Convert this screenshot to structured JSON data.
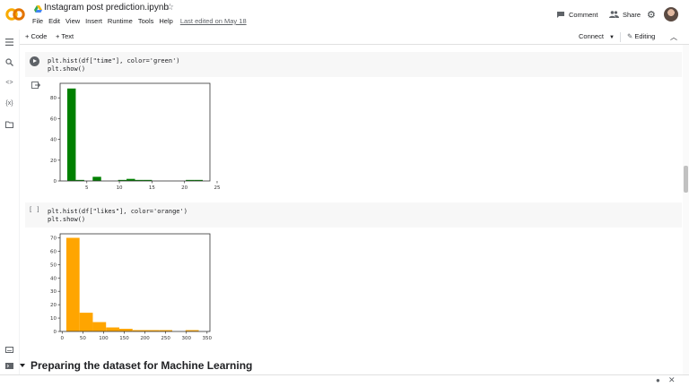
{
  "header": {
    "title": "Instagram post prediction.ipynb",
    "menu": [
      "File",
      "Edit",
      "View",
      "Insert",
      "Runtime",
      "Tools",
      "Help"
    ],
    "last_edited": "Last edited on May 18",
    "comment_label": "Comment",
    "share_label": "Share"
  },
  "toolbar": {
    "add_code": "+ Code",
    "add_text": "+ Text",
    "connect": "Connect",
    "editing": "Editing"
  },
  "cells": [
    {
      "run_state": "run-button",
      "code_lines": [
        "plt.hist(df[\"time\"], color='green')",
        "plt.show()"
      ]
    },
    {
      "run_state": "[ ]",
      "code_lines": [
        "plt.hist(df[\"likes\"], color='orange')",
        "plt.show()"
      ]
    }
  ],
  "section": {
    "title": "Preparing the dataset for Machine Learning"
  },
  "colors": {
    "green": "#008000",
    "orange": "#ffa500",
    "accent": "#f9ab00"
  },
  "chart_data": [
    {
      "type": "bar",
      "title": "",
      "xlabel": "",
      "ylabel": "",
      "color": "#008000",
      "bins": [
        [
          2,
          3.3
        ],
        [
          3.3,
          4.6
        ],
        [
          4.6,
          5.9
        ],
        [
          5.9,
          7.2
        ],
        [
          7.2,
          8.5
        ],
        [
          8.5,
          9.8
        ],
        [
          9.8,
          11.1
        ],
        [
          11.1,
          12.4
        ],
        [
          12.4,
          13.7
        ],
        [
          13.7,
          15.0
        ],
        [
          15.0,
          16.3
        ],
        [
          16.3,
          17.6
        ],
        [
          17.6,
          18.9
        ],
        [
          18.9,
          20.2
        ],
        [
          20.2,
          21.5
        ],
        [
          21.5,
          22.8
        ]
      ],
      "values": [
        89,
        1,
        0,
        4,
        0,
        0,
        1,
        2,
        1,
        1,
        0,
        0,
        0,
        0,
        1,
        1
      ],
      "xlim": [
        0.9,
        23.9
      ],
      "ylim": [
        0,
        94
      ],
      "xticks": [
        5,
        10,
        15,
        20,
        25
      ],
      "yticks": [
        0,
        20,
        40,
        60,
        80
      ]
    },
    {
      "type": "bar",
      "title": "",
      "xlabel": "",
      "ylabel": "",
      "color": "#ffa500",
      "bins": [
        [
          10,
          42
        ],
        [
          42,
          74
        ],
        [
          74,
          106
        ],
        [
          106,
          138
        ],
        [
          138,
          170
        ],
        [
          170,
          202
        ],
        [
          202,
          234
        ],
        [
          234,
          266
        ],
        [
          266,
          298
        ],
        [
          298,
          330
        ]
      ],
      "values": [
        70,
        14,
        7,
        3,
        2,
        1,
        1,
        1,
        0,
        1
      ],
      "xlim": [
        -5,
        357
      ],
      "ylim": [
        0,
        73
      ],
      "xticks": [
        0,
        50,
        100,
        150,
        200,
        250,
        300,
        350
      ],
      "yticks": [
        0,
        10,
        20,
        30,
        40,
        50,
        60,
        70
      ]
    }
  ]
}
